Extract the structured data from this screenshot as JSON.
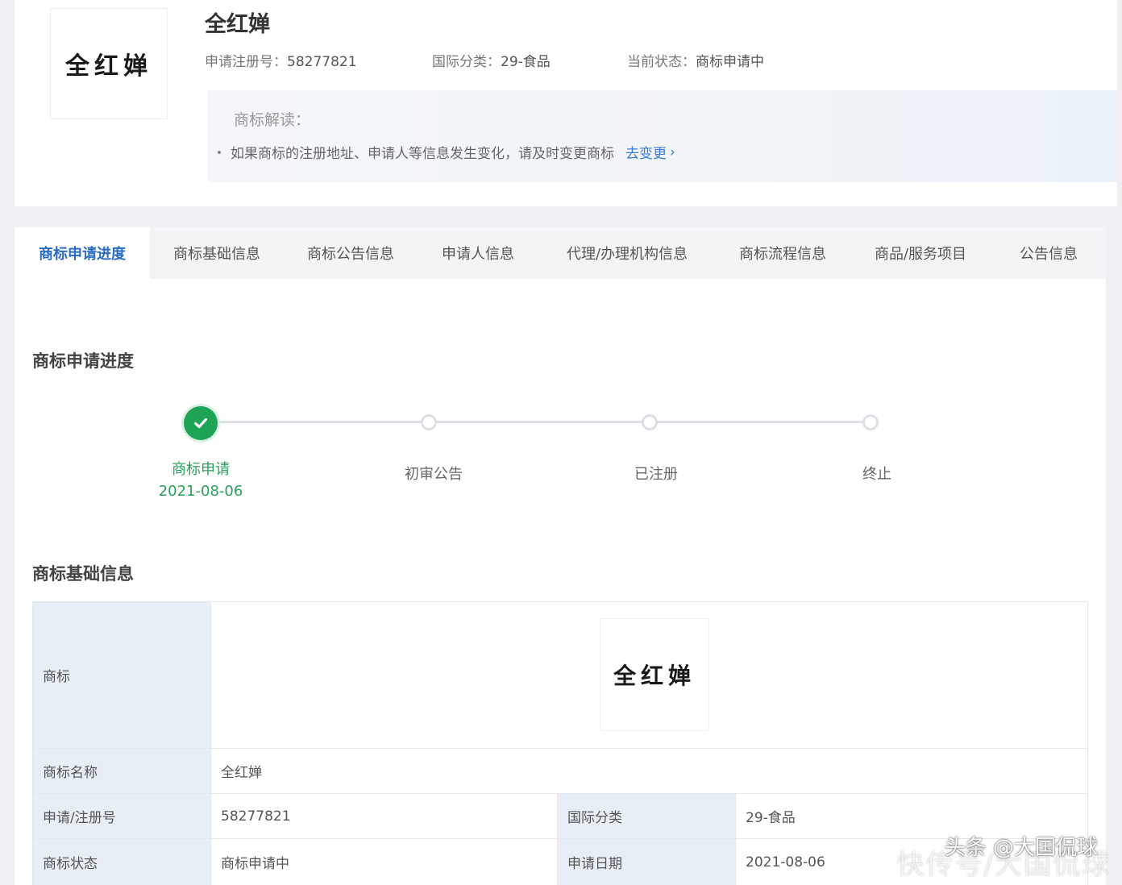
{
  "header": {
    "logo_text": "全红婵",
    "title": "全红婵",
    "reg_no_label": "申请注册号：",
    "reg_no": "58277821",
    "intl_class_label": "国际分类：",
    "intl_class": "29-食品",
    "status_label": "当前状态：",
    "status": "商标申请中",
    "reading_title": "商标解读：",
    "reading_tip": "如果商标的注册地址、申请人等信息发生变化，请及时变更商标",
    "reading_link": "去变更",
    "chevron": "›"
  },
  "tabs": [
    {
      "label": "商标申请进度",
      "active": true
    },
    {
      "label": "商标基础信息"
    },
    {
      "label": "商标公告信息"
    },
    {
      "label": "申请人信息"
    },
    {
      "label": "代理/办理机构信息"
    },
    {
      "label": "商标流程信息"
    },
    {
      "label": "商品/服务项目"
    },
    {
      "label": "公告信息"
    }
  ],
  "progress": {
    "title": "商标申请进度",
    "steps": [
      {
        "label": "商标申请",
        "date": "2021-08-06",
        "done": true
      },
      {
        "label": "初审公告"
      },
      {
        "label": "已注册"
      },
      {
        "label": "终止"
      }
    ]
  },
  "basic_info": {
    "title": "商标基础信息",
    "trademark_label": "商标",
    "trademark_image_text": "全红婵",
    "name_label": "商标名称",
    "name": "全红婵",
    "reg_no_label": "申请/注册号",
    "reg_no": "58277821",
    "intl_class_label": "国际分类",
    "intl_class": "29-食品",
    "status_label": "商标状态",
    "status": "商标申请中",
    "apply_date_label": "申请日期",
    "apply_date": "2021-08-06"
  },
  "watermark": {
    "text": "头条 @大国侃球",
    "faint_text": "快传号/大国侃球"
  },
  "colors": {
    "accent": "#2b6cc4",
    "success": "#1ea456",
    "table_key_bg": "#e8eef6"
  }
}
